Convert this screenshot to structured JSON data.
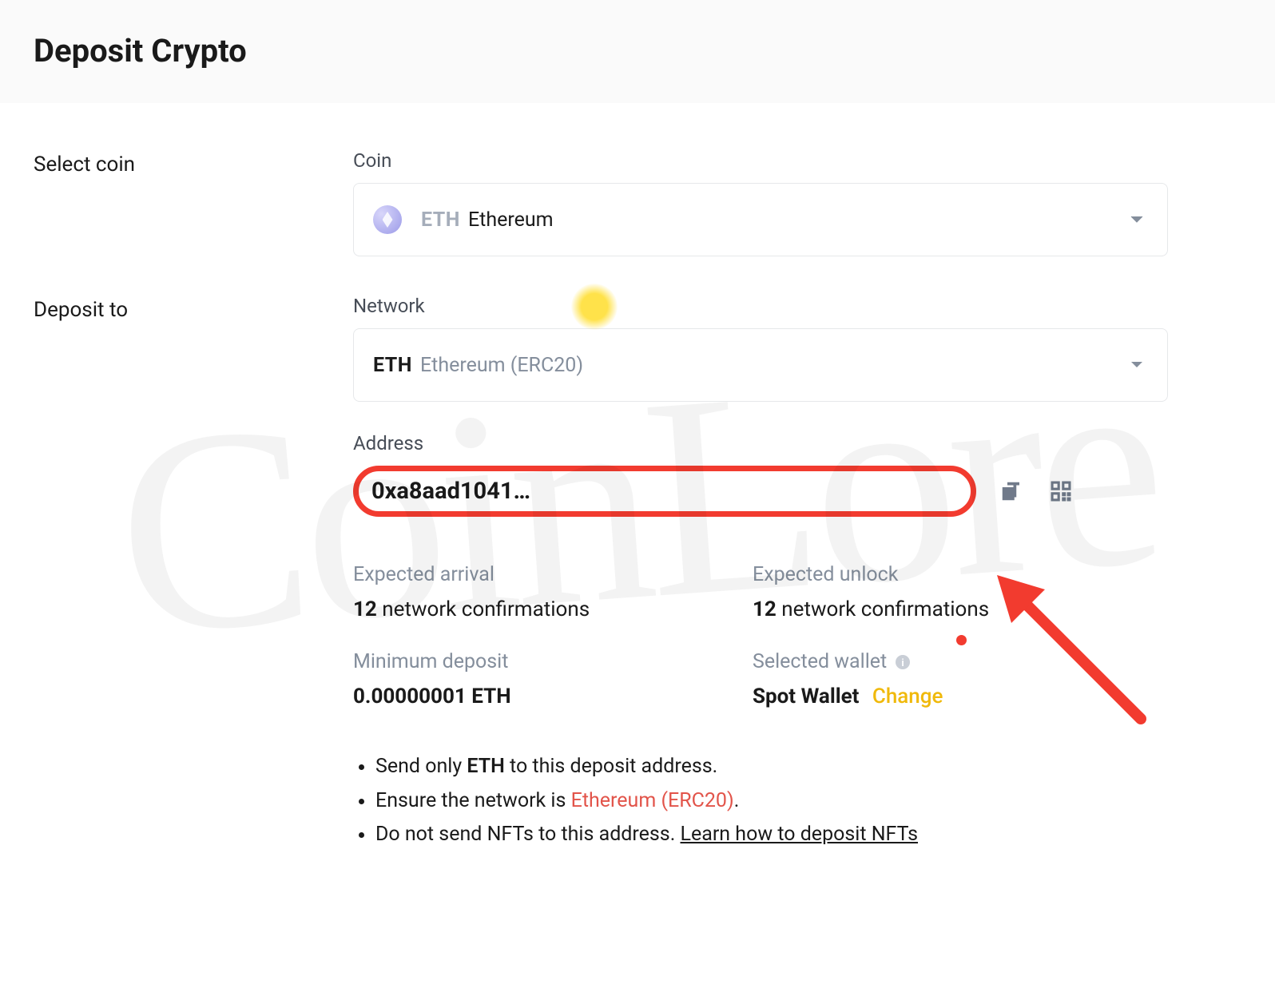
{
  "header": {
    "title": "Deposit Crypto"
  },
  "select_coin": {
    "section_label": "Select coin",
    "field_label": "Coin",
    "symbol": "ETH",
    "name": "Ethereum"
  },
  "deposit_to": {
    "section_label": "Deposit to",
    "network": {
      "field_label": "Network",
      "symbol": "ETH",
      "name": "Ethereum (ERC20)"
    },
    "address": {
      "field_label": "Address",
      "value": "0xa8aad1041…"
    },
    "info": {
      "expected_arrival_label": "Expected arrival",
      "expected_arrival_count": "12",
      "expected_arrival_suffix": "network confirmations",
      "expected_unlock_label": "Expected unlock",
      "expected_unlock_count": "12",
      "expected_unlock_suffix": "network confirmations",
      "min_deposit_label": "Minimum deposit",
      "min_deposit_value": "0.00000001 ETH",
      "selected_wallet_label": "Selected wallet",
      "selected_wallet_value": "Spot Wallet",
      "change_label": "Change"
    },
    "notes": {
      "n1_a": "Send only ",
      "n1_b": "ETH",
      "n1_c": " to this deposit address.",
      "n2_a": "Ensure the network is ",
      "n2_b": "Ethereum (ERC20)",
      "n2_c": ".",
      "n3_a": "Do not send NFTs to this address. ",
      "n3_b": "Learn how to deposit NFTs"
    }
  }
}
